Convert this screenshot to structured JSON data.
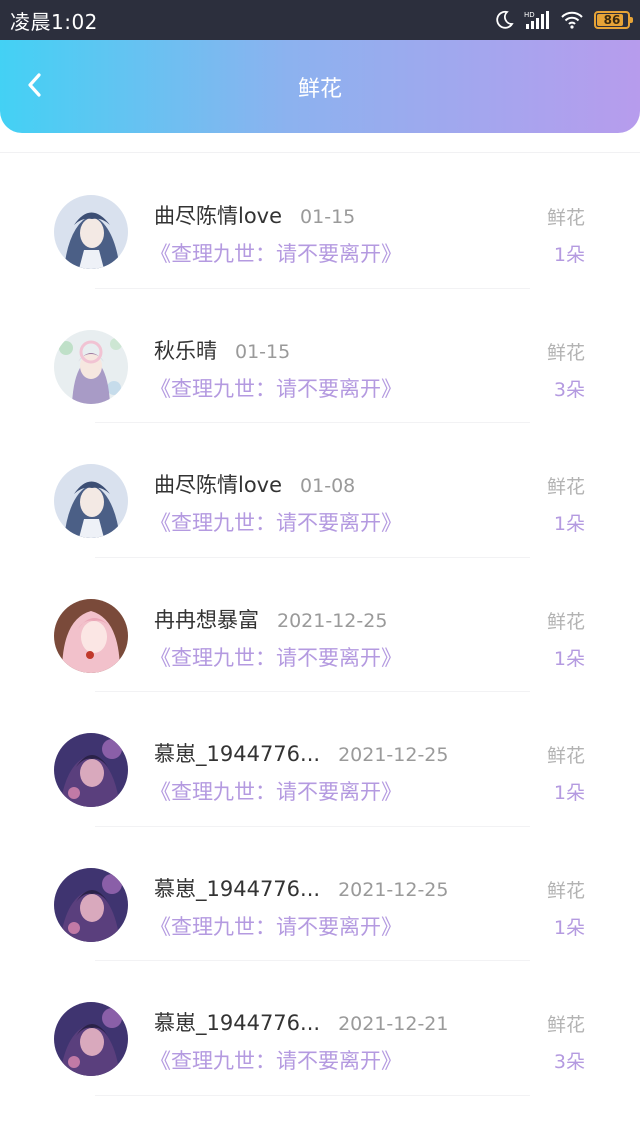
{
  "status_bar": {
    "time": "凌晨1:02",
    "battery": "86",
    "icons": [
      "moon-icon",
      "hd-signal-icon",
      "wifi-icon",
      "battery-icon"
    ]
  },
  "header": {
    "title": "鲜花",
    "back_icon": "chevron-left-icon",
    "gradient": [
      "#43d1f4",
      "#b79ced"
    ]
  },
  "colors": {
    "accent": "#b49ae0",
    "name": "#333333",
    "muted": "#9a9a9a"
  },
  "records": [
    {
      "name": "曲尽陈情love",
      "date": "01-15",
      "book": "《查理九世：请不要离开》",
      "gift_label": "鲜花",
      "count": "1朵",
      "avatar": "avatar-blue"
    },
    {
      "name": "秋乐晴",
      "date": "01-15",
      "book": "《查理九世：请不要离开》",
      "gift_label": "鲜花",
      "count": "3朵",
      "avatar": "avatar-floral"
    },
    {
      "name": "曲尽陈情love",
      "date": "01-08",
      "book": "《查理九世：请不要离开》",
      "gift_label": "鲜花",
      "count": "1朵",
      "avatar": "avatar-blue"
    },
    {
      "name": "冉冉想暴富",
      "date": "2021-12-25",
      "book": "《查理九世：请不要离开》",
      "gift_label": "鲜花",
      "count": "1朵",
      "avatar": "avatar-pink"
    },
    {
      "name": "慕崽_1944776...",
      "date": "2021-12-25",
      "book": "《查理九世：请不要离开》",
      "gift_label": "鲜花",
      "count": "1朵",
      "avatar": "avatar-purple"
    },
    {
      "name": "慕崽_1944776...",
      "date": "2021-12-25",
      "book": "《查理九世：请不要离开》",
      "gift_label": "鲜花",
      "count": "1朵",
      "avatar": "avatar-purple"
    },
    {
      "name": "慕崽_1944776...",
      "date": "2021-12-21",
      "book": "《查理九世：请不要离开》",
      "gift_label": "鲜花",
      "count": "3朵",
      "avatar": "avatar-purple"
    }
  ]
}
